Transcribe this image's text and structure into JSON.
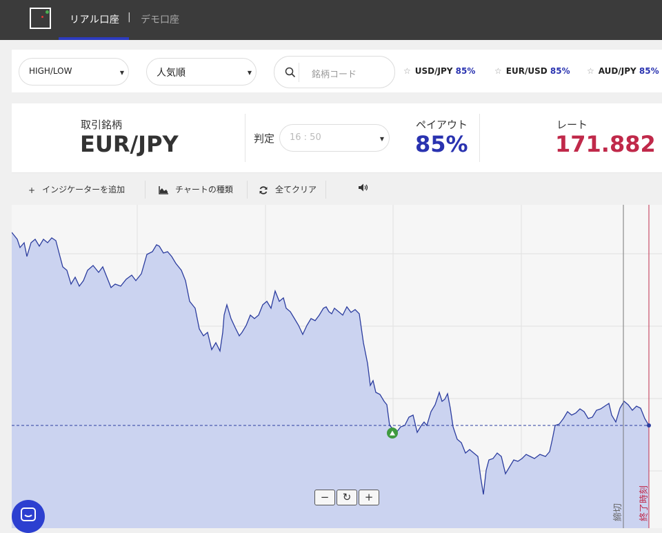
{
  "header": {
    "tabs": [
      {
        "label": "リアル口座",
        "active": true
      },
      {
        "label": "デモ口座",
        "active": false
      }
    ],
    "separator": "|"
  },
  "filters": {
    "trade_type": "HIGH/LOW",
    "sort": "人気順",
    "search_placeholder": "銘柄コード"
  },
  "favorites": [
    {
      "pair": "USD/JPY",
      "payout": "85%"
    },
    {
      "pair": "EUR/USD",
      "payout": "85%"
    },
    {
      "pair": "AUD/JPY",
      "payout": "85%"
    }
  ],
  "asset": {
    "label": "取引銘柄",
    "name": "EUR/JPY",
    "expiry_label": "判定",
    "expiry_value": "16 : 50",
    "payout_label": "ペイアウト",
    "payout_value": "85%",
    "rate_label": "レート",
    "rate_value": "171.882"
  },
  "toolbar": {
    "add_indicator": "インジケーターを追加",
    "chart_type": "チャートの種類",
    "clear_all": "全てクリア"
  },
  "chart": {
    "deadline_label": "締切",
    "end_label": "終了時刻",
    "zoom_out": "−",
    "zoom_reset": "↻",
    "zoom_in": "+"
  },
  "colors": {
    "accent": "#2a33b0",
    "rate": "#c0294a",
    "area_fill": "#cbd3f0",
    "line": "#2b3c9e",
    "topbar": "#3b3b3b"
  }
}
